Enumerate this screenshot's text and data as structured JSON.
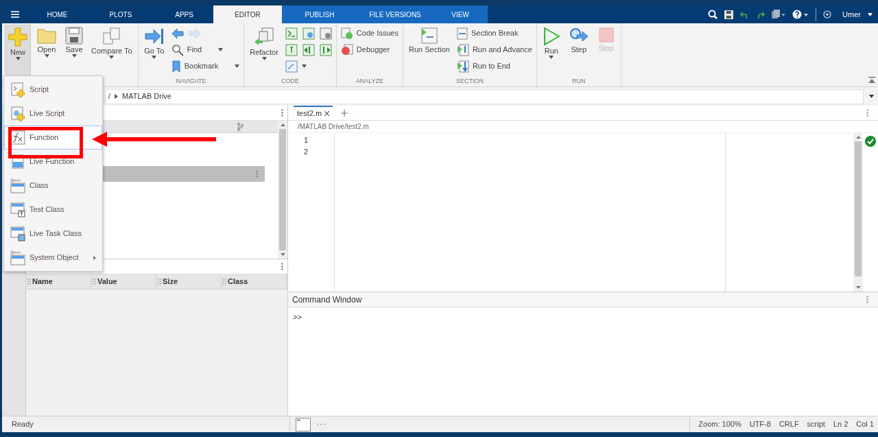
{
  "toolstrip_tabs": [
    {
      "label": "HOME",
      "selected": false,
      "contextual": false
    },
    {
      "label": "PLOTS",
      "selected": false,
      "contextual": false
    },
    {
      "label": "APPS",
      "selected": false,
      "contextual": false
    },
    {
      "label": "EDITOR",
      "selected": true,
      "contextual": true
    },
    {
      "label": "PUBLISH",
      "selected": false,
      "contextual": true
    },
    {
      "label": "FILE VERSIONS",
      "selected": false,
      "contextual": true
    },
    {
      "label": "VIEW",
      "selected": false,
      "contextual": true
    }
  ],
  "user": {
    "name": "Umer"
  },
  "ribbon_groups": [
    {
      "columns": [
        [
          [
            {
              "kind": "large",
              "label": "New",
              "dropdown": true,
              "pressed": true,
              "disabled": false
            }
          ]
        ],
        [
          [
            {
              "kind": "large",
              "label": "Open",
              "dropdown": true,
              "pressed": false,
              "disabled": false
            }
          ]
        ],
        [
          [
            {
              "kind": "large",
              "label": "Save",
              "dropdown": true,
              "pressed": false,
              "disabled": false
            }
          ]
        ],
        [
          [
            {
              "kind": "large",
              "label": "Compare To",
              "dropdown": true,
              "pressed": false,
              "disabled": false
            }
          ]
        ]
      ]
    },
    {
      "title": "NAVIGATE",
      "columns": [
        [
          [
            {
              "kind": "large",
              "label": "Go To",
              "dropdown": true,
              "pressed": false,
              "disabled": false
            }
          ]
        ],
        [
          [
            {
              "kind": "icon",
              "dropdown": false,
              "pressed": false,
              "disabled": false
            },
            {
              "kind": "icon",
              "dropdown": false,
              "pressed": false,
              "disabled": true
            }
          ],
          [
            {
              "kind": "small",
              "label": "Find",
              "dropdown": true,
              "pressed": false,
              "disabled": false
            }
          ],
          [
            {
              "kind": "small",
              "label": "Bookmark",
              "dropdown": true,
              "pressed": false,
              "disabled": false
            }
          ]
        ]
      ]
    },
    {
      "title": "CODE",
      "columns": [
        [
          [
            {
              "kind": "large",
              "label": "Refactor",
              "dropdown": true,
              "pressed": false,
              "disabled": false
            }
          ]
        ],
        [
          [
            {
              "kind": "icon",
              "dropdown": false,
              "pressed": false,
              "disabled": false
            },
            {
              "kind": "icon",
              "dropdown": false,
              "pressed": false,
              "disabled": false
            },
            {
              "kind": "icon",
              "dropdown": false,
              "pressed": false,
              "disabled": false
            }
          ],
          [
            {
              "kind": "icon",
              "dropdown": false,
              "pressed": false,
              "disabled": false
            },
            {
              "kind": "icon",
              "dropdown": false,
              "pressed": false,
              "disabled": false
            },
            {
              "kind": "icon",
              "dropdown": false,
              "pressed": false,
              "disabled": false
            }
          ],
          [
            {
              "kind": "icon",
              "dropdown": true,
              "pressed": false,
              "disabled": false
            }
          ]
        ]
      ]
    },
    {
      "title": "ANALYZE",
      "columns": [
        [
          [
            {
              "kind": "small",
              "label": "Code Issues",
              "dropdown": false,
              "pressed": false,
              "disabled": false
            }
          ],
          [
            {
              "kind": "small",
              "label": "Debugger",
              "dropdown": false,
              "pressed": false,
              "disabled": false
            }
          ]
        ]
      ]
    },
    {
      "title": "SECTION",
      "columns": [
        [
          [
            {
              "kind": "large",
              "label": "Run Section",
              "dropdown": false,
              "pressed": false,
              "disabled": false
            }
          ]
        ],
        [
          [
            {
              "kind": "small",
              "label": "Section Break",
              "dropdown": false,
              "pressed": false,
              "disabled": false
            }
          ],
          [
            {
              "kind": "small",
              "label": "Run and Advance",
              "dropdown": false,
              "pressed": false,
              "disabled": false
            }
          ],
          [
            {
              "kind": "small",
              "label": "Run to End",
              "dropdown": false,
              "pressed": false,
              "disabled": false
            }
          ]
        ]
      ]
    },
    {
      "title": "RUN",
      "columns": [
        [
          [
            {
              "kind": "large",
              "label": "Run",
              "dropdown": true,
              "pressed": false,
              "disabled": false
            }
          ]
        ],
        [
          [
            {
              "kind": "large",
              "label": "Step",
              "dropdown": false,
              "pressed": false,
              "disabled": false
            }
          ]
        ],
        [
          [
            {
              "kind": "large",
              "label": "Stop",
              "dropdown": false,
              "pressed": false,
              "disabled": true
            }
          ]
        ]
      ]
    }
  ],
  "new_menu": [
    {
      "label": "Script",
      "selected": false,
      "submenu": false,
      "annotated": false
    },
    {
      "label": "Live Script",
      "selected": false,
      "submenu": false,
      "annotated": false
    },
    {
      "label": "Function",
      "selected": true,
      "submenu": false,
      "annotated": true
    },
    {
      "label": "Live Function",
      "selected": false,
      "submenu": false,
      "annotated": false
    },
    {
      "label": "Class",
      "selected": false,
      "submenu": false,
      "annotated": false
    },
    {
      "label": "Test Class",
      "selected": false,
      "submenu": false,
      "annotated": false
    },
    {
      "label": "Live Task Class",
      "selected": false,
      "submenu": false,
      "annotated": false
    },
    {
      "label": "System Object",
      "selected": false,
      "submenu": true,
      "annotated": false
    }
  ],
  "address_bar": {
    "separator": "/",
    "folder": "MATLAB Drive"
  },
  "workspace": {
    "columns": [
      "Name",
      "Value",
      "Size",
      "Class"
    ]
  },
  "editor": {
    "tabs": [
      {
        "label": "test2.m",
        "selected": true
      }
    ],
    "path": "/MATLAB Drive/test2.m",
    "line_numbers": [
      "1",
      "2"
    ]
  },
  "command_window": {
    "title": "Command Window",
    "prompt": ">>"
  },
  "status_bar": {
    "left": "Ready",
    "right": [
      "Zoom: 100%",
      "UTF-8",
      "CRLF",
      "script",
      "Ln 2",
      "Col 1"
    ]
  }
}
